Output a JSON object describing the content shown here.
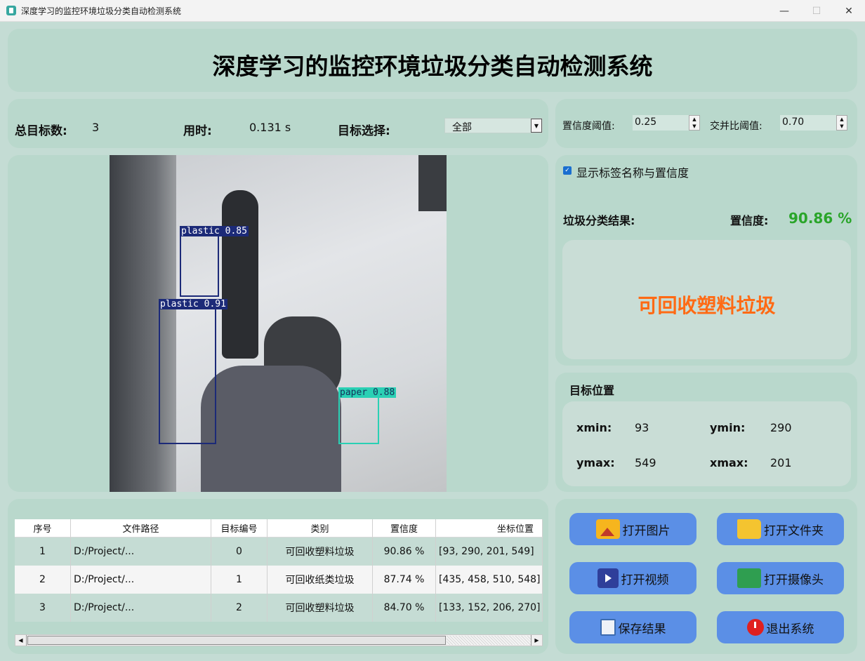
{
  "window": {
    "title": "深度学习的监控环境垃圾分类自动检测系统",
    "min": "—",
    "max": "☐",
    "close": "✕"
  },
  "header": {
    "title": "深度学习的监控环境垃圾分类自动检测系统"
  },
  "stats": {
    "total_label": "总目标数:",
    "total_value": "3",
    "time_label": "用时:",
    "time_value": "0.131 s",
    "select_label": "目标选择:",
    "select_value": "全部"
  },
  "thresholds": {
    "conf_label": "置信度阈值:",
    "conf_value": "0.25",
    "iou_label": "交并比阈值:",
    "iou_value": "0.70"
  },
  "image": {
    "detections": [
      {
        "label": "plastic  0.85"
      },
      {
        "label": "plastic  0.91"
      },
      {
        "label": "paper  0.88"
      }
    ]
  },
  "result": {
    "show_labels": "显示标签名称与置信度",
    "class_label": "垃圾分类结果:",
    "conf_label": "置信度:",
    "conf_value": "90.86 %",
    "class_value": "可回收塑料垃圾",
    "conf_color": "#2aa52a",
    "class_color": "#ff6a14"
  },
  "position": {
    "title": "目标位置",
    "xmin_label": "xmin:",
    "xmin": "93",
    "ymin_label": "ymin:",
    "ymin": "290",
    "ymax_label": "ymax:",
    "ymax": "549",
    "xmax_label": "xmax:",
    "xmax": "201"
  },
  "table": {
    "headers": [
      "序号",
      "文件路径",
      "目标编号",
      "类别",
      "置信度",
      "坐标位置"
    ],
    "rows": [
      [
        "1",
        "D:/Project/...",
        "0",
        "可回收塑料垃圾",
        "90.86 %",
        "[93, 290, 201, 549]"
      ],
      [
        "2",
        "D:/Project/...",
        "1",
        "可回收纸类垃圾",
        "87.74 %",
        "[435, 458, 510, 548]"
      ],
      [
        "3",
        "D:/Project/...",
        "2",
        "可回收塑料垃圾",
        "84.70 %",
        "[133, 152, 206, 270]"
      ]
    ]
  },
  "buttons": {
    "open_image": "打开图片",
    "open_folder": "打开文件夹",
    "open_video": "打开视频",
    "open_camera": "打开摄像头",
    "save": "保存结果",
    "exit": "退出系统"
  },
  "icons": {
    "app": "app-icon",
    "open_image": "image-icon",
    "open_folder": "folder-icon",
    "open_video": "video-icon",
    "open_camera": "camera-icon",
    "save": "save-icon",
    "exit": "power-icon"
  },
  "colors": {
    "button": "#5b8fe6",
    "background": "#c4dcd4",
    "panel": "#b9d8cc"
  }
}
